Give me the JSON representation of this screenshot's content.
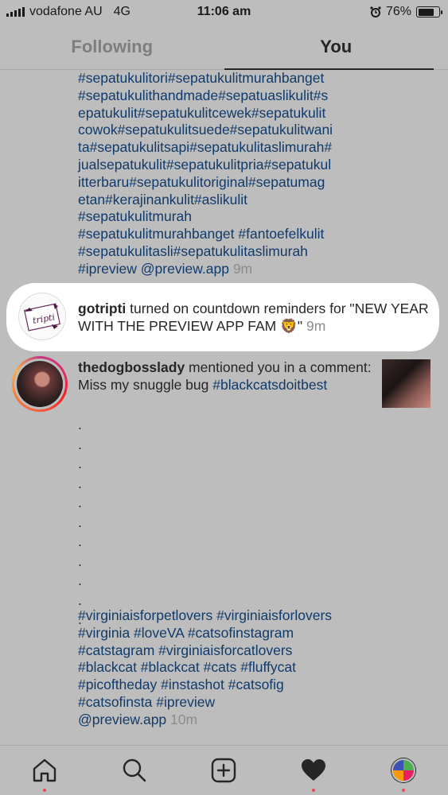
{
  "status_bar": {
    "carrier": "vodafone AU",
    "network": "4G",
    "time": "11:06 am",
    "battery": "76%",
    "battery_level": 0.76,
    "icons": [
      "signal-icon",
      "alarm-icon",
      "battery-icon"
    ]
  },
  "tabs": [
    {
      "label": "Following",
      "active": false
    },
    {
      "label": "You",
      "active": true
    }
  ],
  "feed": {
    "first_caption": {
      "lines": [
        "#sepatukulitori#sepatukulitmurahbanget",
        "#sepatukulithandmade#sepatuaslikulit#s",
        "epatukulit#sepatukulitcewek#sepatukulit",
        "cowok#sepatukulitsuede#sepatukulitwani",
        "ta#sepatukulitsapi#sepatukulitaslimurah#",
        "jualsepatukulit#sepatukulitpria#sepatukul",
        "itterbaru#sepatukulitoriginal#sepatumag",
        "etan#kerajinankulit#aslikulit",
        "#sepatukulitmurah",
        "#sepatukulitmurahbanget #fantoefelkulit",
        "#sepatukulitasli#sepatukulitaslimurah",
        "#ipreview @preview.app"
      ],
      "time": "9m"
    },
    "highlight": {
      "username": "gotripti",
      "message": " turned on countdown reminders for \"NEW YEAR WITH THE PREVIEW APP FAM 🦁\"",
      "time": "9m",
      "avatar_text": "tripti"
    },
    "mention": {
      "username": "thedogbosslady",
      "message": " mentioned you in a comment: Miss my snuggle bug ",
      "tag": "#blackcatsdoitbest",
      "dots": [
        ".",
        ".",
        ".",
        ".",
        ".",
        ".",
        ".",
        ".",
        ".",
        ".",
        "."
      ],
      "caption_lines": [
        "#virginiaisforpetlovers #virginiaisforlovers",
        "#virginia #loveVA #catsofinstagram",
        "#catstagram #virginiaisforcatlovers",
        "#blackcat #blackcat #cats #fluffycat",
        "#picoftheday #instashot #catsofig",
        "#catsofinsta #ipreview",
        "@preview.app"
      ],
      "time": "10m"
    }
  },
  "bottom_nav": {
    "items": [
      "home-icon",
      "search-icon",
      "add-post-icon",
      "activity-heart-icon",
      "profile-icon"
    ]
  },
  "colors": {
    "background": "#bdbdbd",
    "hashtag": "#103a6a",
    "notification_dot": "#ed4956",
    "timestamp": "#8c8c8c"
  }
}
